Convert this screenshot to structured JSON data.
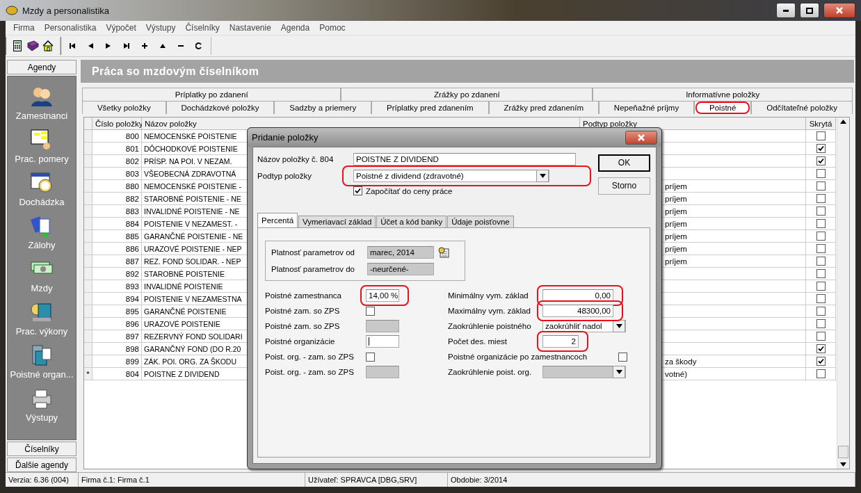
{
  "window": {
    "title": "Mzdy a personalistika"
  },
  "menu": [
    "Firma",
    "Personalistika",
    "Výpočet",
    "Výstupy",
    "Číselníky",
    "Nastavenie",
    "Agenda",
    "Pomoc"
  ],
  "sidebar": {
    "header": "Agendy",
    "items": [
      {
        "label": "Zamestnanci",
        "selected": false
      },
      {
        "label": "Prac. pomery",
        "selected": false
      },
      {
        "label": "Dochádzka",
        "selected": false
      },
      {
        "label": "Zálohy",
        "selected": false
      },
      {
        "label": "Mzdy",
        "selected": false
      },
      {
        "label": "Prac. výkony",
        "selected": false
      },
      {
        "label": "Poistné organ...",
        "selected": false
      },
      {
        "label": "Výstupy",
        "selected": false
      }
    ],
    "footer": [
      "Číselníky",
      "Ďalšie agendy"
    ]
  },
  "heading": "Práca so mzdovým číselníkom",
  "tab_rows": [
    {
      "tabs": [
        {
          "label": "Príplatky po zdanení",
          "selected": false,
          "highlighted": false
        },
        {
          "label": "Zrážky po zdanení",
          "selected": false,
          "highlighted": false
        },
        {
          "label": "Informatívne položky",
          "selected": false,
          "highlighted": false
        }
      ]
    },
    {
      "tabs": [
        {
          "label": "Všetky položky",
          "selected": false,
          "highlighted": false
        },
        {
          "label": "Dochádzkové položky",
          "selected": false,
          "highlighted": false
        },
        {
          "label": "Sadzby a priemery",
          "selected": false,
          "highlighted": false
        },
        {
          "label": "Príplatky pred zdanením",
          "selected": false,
          "highlighted": false
        },
        {
          "label": "Zrážky pred zdanením",
          "selected": false,
          "highlighted": false
        },
        {
          "label": "Nepeňažné príjmy",
          "selected": false,
          "highlighted": false
        },
        {
          "label": "Poistné",
          "selected": true,
          "highlighted": true
        },
        {
          "label": "Odčítateľné položky",
          "selected": false,
          "highlighted": false
        }
      ]
    }
  ],
  "table": {
    "columns": [
      "Číslo položky",
      "Názov položky",
      "Podtyp položky",
      "Skrytá"
    ],
    "rows": [
      {
        "number": "800",
        "name": "NEMOCENSKÉ POISTENIE",
        "hidden": false
      },
      {
        "number": "801",
        "name": "DÔCHODKOVÉ POISTENIE",
        "hidden": true
      },
      {
        "number": "802",
        "name": "PRÍSP. NA POI. V NEZAM.",
        "hidden": true
      },
      {
        "number": "803",
        "name": "VŠEOBECNÁ ZDRAVOTNÁ",
        "hidden": false
      },
      {
        "number": "880",
        "name": "NEMOCENSKÉ POISTENIE -",
        "subtype": "príjem",
        "hidden": false
      },
      {
        "number": "882",
        "name": "STAROBNÉ POISTENIE - NE",
        "subtype": "príjem",
        "hidden": false
      },
      {
        "number": "883",
        "name": "INVALIDNÉ POISTENIE - NE",
        "subtype": "príjem",
        "hidden": false
      },
      {
        "number": "884",
        "name": "POISTENIE V NEZAMEST. -",
        "subtype": "príjem",
        "hidden": false
      },
      {
        "number": "885",
        "name": "GARANČNÉ POISTENIE - NE",
        "subtype": "príjem",
        "hidden": false
      },
      {
        "number": "886",
        "name": "URAZOVÉ POISTENIE - NEP",
        "subtype": "príjem",
        "hidden": false
      },
      {
        "number": "887",
        "name": "REZ. FOND SOLIDAR. - NEP",
        "subtype": "príjem",
        "hidden": false
      },
      {
        "number": "892",
        "name": "STAROBNÉ POISTENIE",
        "hidden": false
      },
      {
        "number": "893",
        "name": "INVALIDNÉ POISTENIE",
        "hidden": false
      },
      {
        "number": "894",
        "name": "POISTENIE V NEZAMESTNA",
        "hidden": false
      },
      {
        "number": "895",
        "name": "GARANČNÉ POISTENIE",
        "hidden": false
      },
      {
        "number": "896",
        "name": "URAZOVÉ POISTENIE",
        "hidden": false
      },
      {
        "number": "897",
        "name": "REZERVNÝ FOND SOLIDARI",
        "hidden": false
      },
      {
        "number": "898",
        "name": "GARANČNÝ FOND (DO R.20",
        "hidden": true
      },
      {
        "number": "899",
        "name": "ZÁK. POI. ORG. ZA ŠKODU",
        "subtype": "za škody",
        "hidden": true
      },
      {
        "marker": "*",
        "number": "804",
        "name": "POISTNE Z DIVIDEND",
        "subtype": "votné)",
        "hidden": false
      }
    ]
  },
  "dialog": {
    "title": "Pridanie položky",
    "name_label": "Názov položky č.  804",
    "name_value": "POISTNE Z DIVIDEND",
    "subtype_label": "Podtyp položky",
    "subtype_value": "Poistné z dividend (zdravotné)",
    "subtype_highlighted": true,
    "include": {
      "label": "Započítať do ceny práce",
      "checked": true
    },
    "buttons": [
      "OK",
      "Storno"
    ],
    "tabs": [
      {
        "label": "Percentá",
        "selected": true
      },
      {
        "label": "Vymeriavací základ",
        "selected": false
      },
      {
        "label": "Účet a kód banky",
        "selected": false
      },
      {
        "label": "Údaje poisťovne",
        "selected": false
      }
    ],
    "validity": [
      {
        "label": "Platnosť parametrov od",
        "value": "marec, 2014"
      },
      {
        "label": "Platnosť parametrov do",
        "value": "-neurčené-"
      }
    ],
    "left_fields": [
      {
        "kind": "text",
        "label": "Poistné zamestnanca",
        "value": "14,00 %",
        "highlighted": true
      },
      {
        "kind": "checkbox",
        "label": "Poistné zam. so ZPS",
        "checked": false
      },
      {
        "kind": "disabled",
        "label": "Poistné zam. so ZPS"
      },
      {
        "kind": "text",
        "label": "Poistné organizácie"
      },
      {
        "kind": "checkbox",
        "label": "Poist. org. - zam. so ZPS",
        "checked": false
      },
      {
        "kind": "disabled",
        "label": "Poist. org. - zam. so ZPS"
      }
    ],
    "right_fields": [
      {
        "kind": "text",
        "label": "Minimálny vym. základ",
        "value": "0,00",
        "highlighted": true
      },
      {
        "kind": "text",
        "label": "Maximálny vym. základ",
        "value": "48300,00",
        "highlighted": true
      },
      {
        "kind": "select",
        "label": "Zaokrúhlenie poistného",
        "value": "zaokrúhliť nadol",
        "disabled": false
      },
      {
        "kind": "short",
        "label": "Počet des. miest",
        "value": "2",
        "highlighted": true
      },
      {
        "kind": "checkbox",
        "label": "Poistné organizácie po zamestnancoch",
        "checked": false
      },
      {
        "kind": "select",
        "label": "Zaokrúhlenie poist. org.",
        "disabled": true
      }
    ]
  },
  "status_bar": [
    "Verzia: 6.36 (004)",
    "Firma č.1: Firma č.1",
    "Užívateľ: SPRAVCA [DBG,SRV]",
    "Obdobie: 3/2014"
  ]
}
